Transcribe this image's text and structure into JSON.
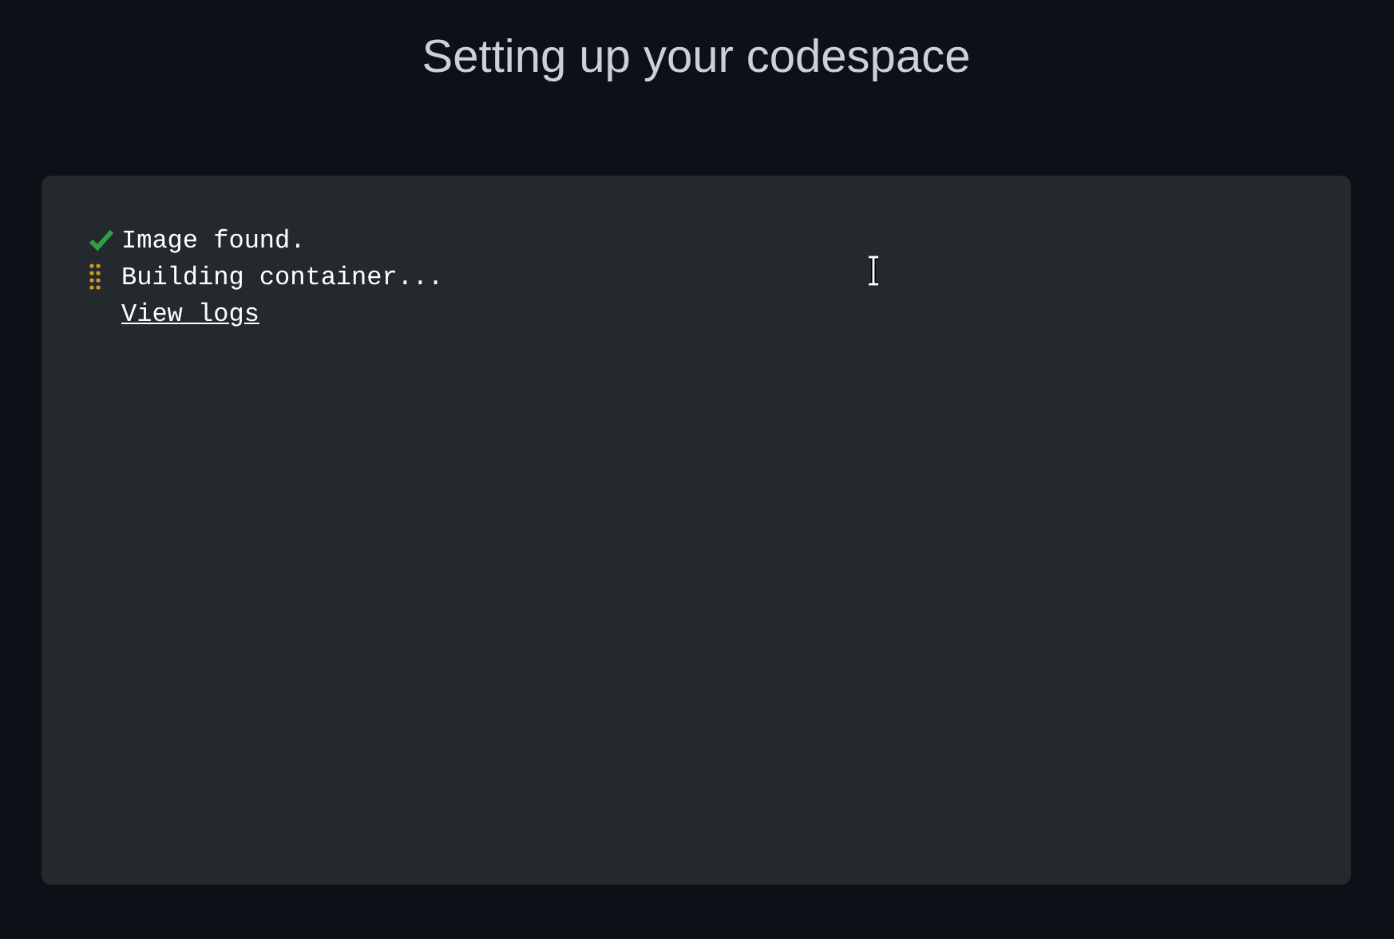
{
  "title": "Setting up your codespace",
  "steps": [
    {
      "kind": "done",
      "text": "Image found."
    },
    {
      "kind": "progress",
      "text": "Building container..."
    }
  ],
  "link": "View logs"
}
